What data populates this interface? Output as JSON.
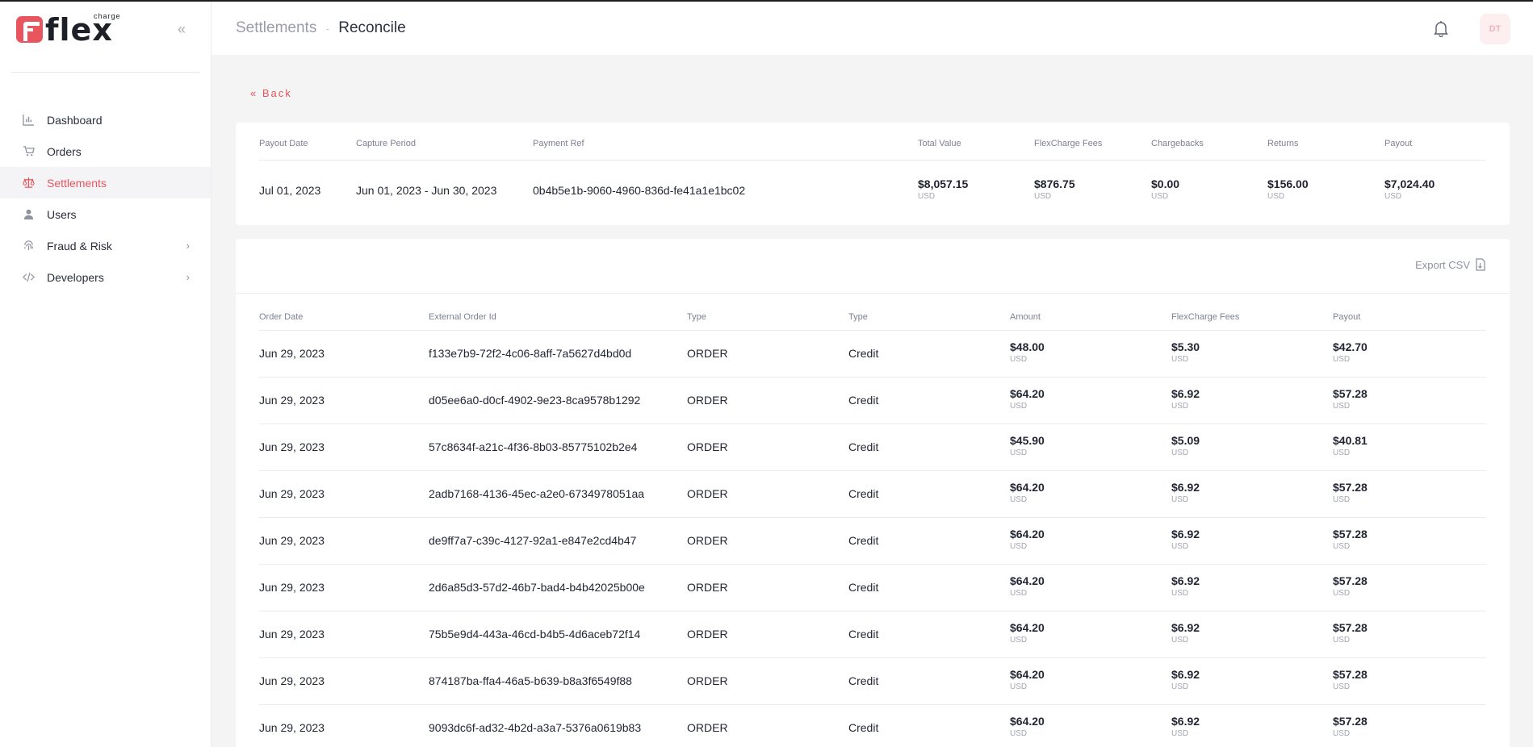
{
  "brand": {
    "name": "flex",
    "superscript": "charge"
  },
  "sidebar": {
    "collapse_label": "«",
    "items": [
      {
        "label": "Dashboard",
        "icon": "bar-chart-icon",
        "active": false,
        "has_children": false
      },
      {
        "label": "Orders",
        "icon": "cart-icon",
        "active": false,
        "has_children": false
      },
      {
        "label": "Settlements",
        "icon": "scale-icon",
        "active": true,
        "has_children": false
      },
      {
        "label": "Users",
        "icon": "user-icon",
        "active": false,
        "has_children": false
      },
      {
        "label": "Fraud & Risk",
        "icon": "fingerprint-icon",
        "active": false,
        "has_children": true
      },
      {
        "label": "Developers",
        "icon": "code-icon",
        "active": false,
        "has_children": true
      }
    ]
  },
  "header": {
    "breadcrumb_parent": "Settlements",
    "breadcrumb_separator": "-",
    "breadcrumb_current": "Reconcile",
    "avatar_initials": "DT"
  },
  "back_label": "Back",
  "summary": {
    "headers": {
      "payout_date": "Payout Date",
      "capture_period": "Capture Period",
      "payment_ref": "Payment Ref",
      "total_value": "Total Value",
      "fees": "FlexCharge Fees",
      "chargebacks": "Chargebacks",
      "returns": "Returns",
      "payout": "Payout"
    },
    "values": {
      "payout_date": "Jul 01, 2023",
      "capture_period": "Jun 01, 2023 - Jun 30, 2023",
      "payment_ref": "0b4b5e1b-9060-4960-836d-fe41a1e1bc02",
      "total_value": "$8,057.15",
      "fees": "$876.75",
      "chargebacks": "$0.00",
      "returns": "$156.00",
      "payout": "$7,024.40",
      "currency": "USD"
    }
  },
  "orders": {
    "export_label": "Export CSV",
    "columns": [
      "Order Date",
      "External Order Id",
      "Type",
      "Type",
      "Amount",
      "FlexCharge Fees",
      "Payout"
    ],
    "currency": "USD",
    "rows": [
      {
        "date": "Jun 29, 2023",
        "id": "f133e7b9-72f2-4c06-8aff-7a5627d4bd0d",
        "type": "ORDER",
        "type2": "Credit",
        "amount": "$48.00",
        "fees": "$5.30",
        "payout": "$42.70"
      },
      {
        "date": "Jun 29, 2023",
        "id": "d05ee6a0-d0cf-4902-9e23-8ca9578b1292",
        "type": "ORDER",
        "type2": "Credit",
        "amount": "$64.20",
        "fees": "$6.92",
        "payout": "$57.28"
      },
      {
        "date": "Jun 29, 2023",
        "id": "57c8634f-a21c-4f36-8b03-85775102b2e4",
        "type": "ORDER",
        "type2": "Credit",
        "amount": "$45.90",
        "fees": "$5.09",
        "payout": "$40.81"
      },
      {
        "date": "Jun 29, 2023",
        "id": "2adb7168-4136-45ec-a2e0-6734978051aa",
        "type": "ORDER",
        "type2": "Credit",
        "amount": "$64.20",
        "fees": "$6.92",
        "payout": "$57.28"
      },
      {
        "date": "Jun 29, 2023",
        "id": "de9ff7a7-c39c-4127-92a1-e847e2cd4b47",
        "type": "ORDER",
        "type2": "Credit",
        "amount": "$64.20",
        "fees": "$6.92",
        "payout": "$57.28"
      },
      {
        "date": "Jun 29, 2023",
        "id": "2d6a85d3-57d2-46b7-bad4-b4b42025b00e",
        "type": "ORDER",
        "type2": "Credit",
        "amount": "$64.20",
        "fees": "$6.92",
        "payout": "$57.28"
      },
      {
        "date": "Jun 29, 2023",
        "id": "75b5e9d4-443a-46cd-b4b5-4d6aceb72f14",
        "type": "ORDER",
        "type2": "Credit",
        "amount": "$64.20",
        "fees": "$6.92",
        "payout": "$57.28"
      },
      {
        "date": "Jun 29, 2023",
        "id": "874187ba-ffa4-46a5-b639-b8a3f6549f88",
        "type": "ORDER",
        "type2": "Credit",
        "amount": "$64.20",
        "fees": "$6.92",
        "payout": "$57.28"
      },
      {
        "date": "Jun 29, 2023",
        "id": "9093dc6f-ad32-4b2d-a3a7-5376a0619b83",
        "type": "ORDER",
        "type2": "Credit",
        "amount": "$64.20",
        "fees": "$6.92",
        "payout": "$57.28"
      }
    ]
  },
  "colors": {
    "accent": "#e8555e",
    "muted": "#9a9cab",
    "background": "#f4f4f5"
  }
}
